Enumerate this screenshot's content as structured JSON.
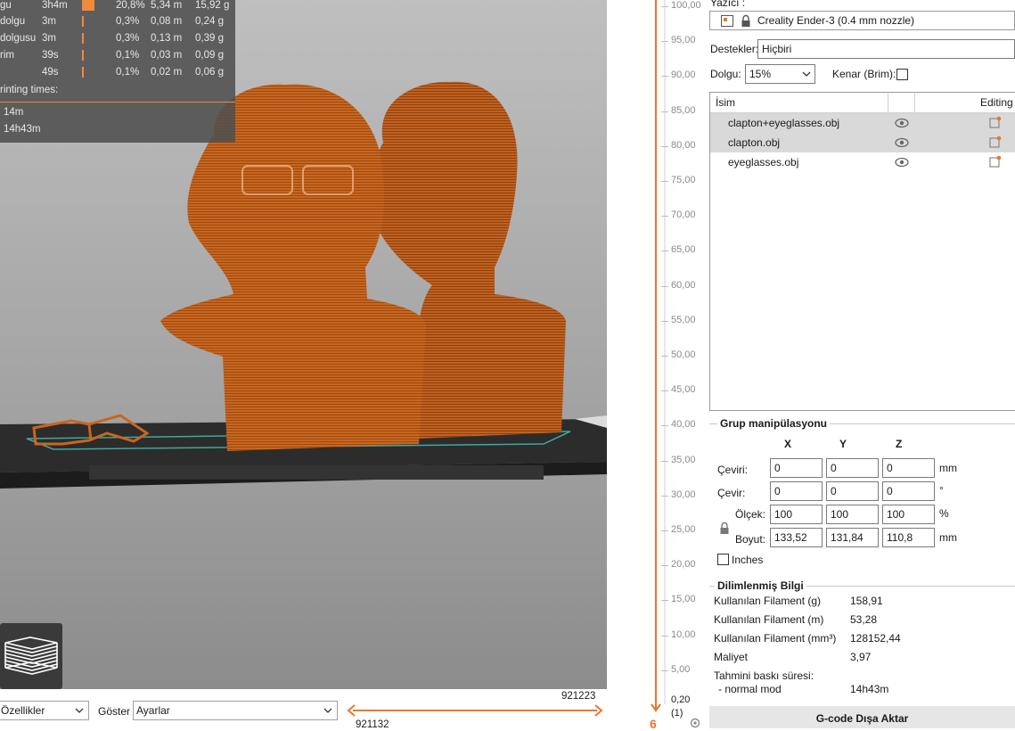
{
  "legend": {
    "rows": [
      {
        "name": "gu",
        "time": "3h4m",
        "percent": "20,8%",
        "meters": "5,34 m",
        "grams": "15,92 g"
      },
      {
        "name": " dolgu",
        "time": "3m",
        "percent": "0,3%",
        "meters": "0,08 m",
        "grams": "0,24 g"
      },
      {
        "name": "dolgusu",
        "time": "3m",
        "percent": "0,3%",
        "meters": "0,13 m",
        "grams": "0,39 g"
      },
      {
        "name": "rim",
        "time": "39s",
        "percent": "0,1%",
        "meters": "0,03 m",
        "grams": "0,09 g"
      },
      {
        "name": "",
        "time": "49s",
        "percent": "0,1%",
        "meters": "0,02 m",
        "grams": "0,06 g"
      }
    ],
    "printing_times_title": "rinting times:",
    "times": [
      "14m",
      "14h43m"
    ],
    "accent": "#f08a3c"
  },
  "bottombar": {
    "view_select": "Özellikler",
    "show_label": "Göster",
    "show_select": "Ayarlar",
    "h_slider_right_value": "921223",
    "h_slider_left_value": "921132"
  },
  "vslider": {
    "ticks": [
      "100,00",
      "95,00",
      "90,00",
      "85,00",
      "80,00",
      "75,00",
      "70,00",
      "65,00",
      "60,00",
      "55,00",
      "50,00",
      "45,00",
      "40,00",
      "35,00",
      "30,00",
      "25,00",
      "20,00",
      "15,00",
      "10,00",
      "5,00"
    ],
    "bottom_value": "0,20",
    "bottom_layer": "(1)",
    "accent": "#e8772e"
  },
  "panel": {
    "printer_label": "Yazıcı :",
    "printer_value": "Creality Ender-3 (0.4 mm nozzle)",
    "supports_label": "Destekler:",
    "supports_value": "Hiçbiri",
    "infill_label": "Dolgu:",
    "infill_value": "15%",
    "brim_label": "Kenar (Brim):",
    "list_header_name": "İsim",
    "list_header_editing": "Editing",
    "objects": [
      {
        "name": "clapton+eyeglasses.obj",
        "selected": true
      },
      {
        "name": "clapton.obj",
        "selected": true
      },
      {
        "name": "eyeglasses.obj",
        "selected": false
      }
    ],
    "group": {
      "title": "Grup manipülasyonu",
      "col_x": "X",
      "col_y": "Y",
      "col_z": "Z",
      "rows": [
        {
          "label": "Çeviri:",
          "x": "0",
          "y": "0",
          "z": "0",
          "unit": "mm"
        },
        {
          "label": "Çevir:",
          "x": "0",
          "y": "0",
          "z": "0",
          "unit": "°"
        },
        {
          "label": "Ölçek:",
          "x": "100",
          "y": "100",
          "z": "100",
          "unit": "%"
        },
        {
          "label": "Boyut:",
          "x": "133,52",
          "y": "131,84",
          "z": "110,8",
          "unit": "mm"
        }
      ],
      "inches_label": "Inches"
    },
    "sliced": {
      "title": "Dilimlenmiş Bilgi",
      "rows": [
        {
          "label": "Kullanılan Filament (g)",
          "value": "158,91"
        },
        {
          "label": "Kullanılan Filament (m)",
          "value": "53,28"
        },
        {
          "label": "Kullanılan Filament (mm³)",
          "value": "128152,44"
        },
        {
          "label": "Maliyet",
          "value": "3,97"
        }
      ],
      "time_label": "Tahmini baskı süresi:",
      "mode_label": "- normal mod",
      "mode_value": "14h43m"
    },
    "export_button": "G-code Dışa Aktar"
  }
}
